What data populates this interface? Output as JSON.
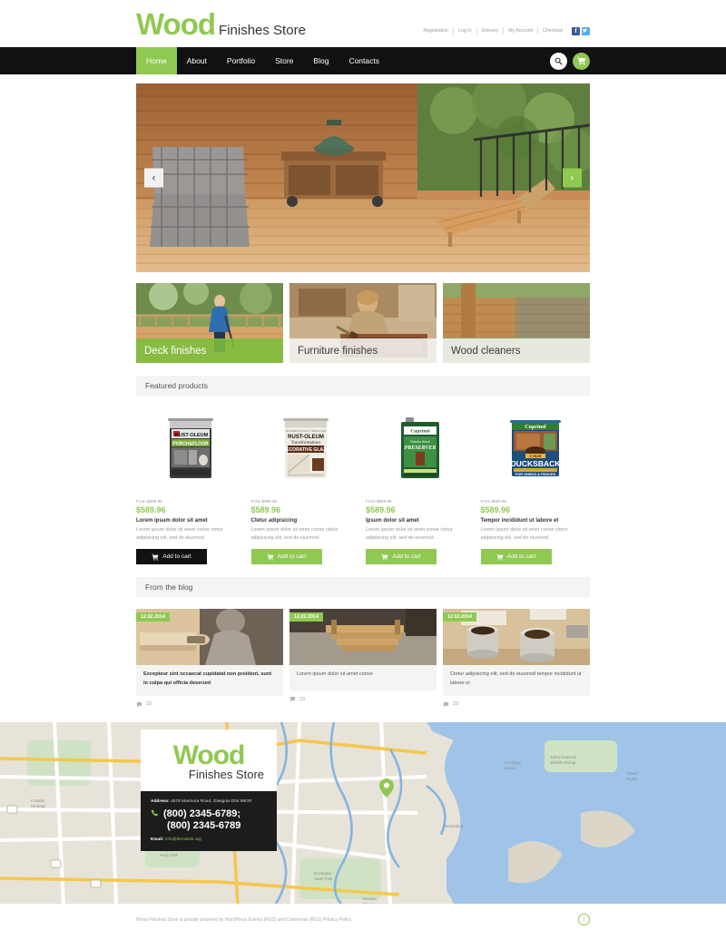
{
  "header": {
    "logo_main": "Wood",
    "logo_sub": "Finishes Store",
    "top_links": [
      {
        "label": "Registration"
      },
      {
        "label": "Log In"
      },
      {
        "label": "Delivery"
      },
      {
        "label": "My Account"
      },
      {
        "label": "Checkout"
      }
    ],
    "social": [
      {
        "name": "facebook-icon",
        "glyph": "f",
        "color": "#3b5998"
      },
      {
        "name": "twitter-icon",
        "glyph": "t",
        "color": "#55acee"
      }
    ]
  },
  "nav": {
    "items": [
      {
        "label": "Home",
        "active": true
      },
      {
        "label": "About",
        "active": false
      },
      {
        "label": "Portfolio",
        "active": false
      },
      {
        "label": "Store",
        "active": false
      },
      {
        "label": "Blog",
        "active": false
      },
      {
        "label": "Contacts",
        "active": false
      }
    ],
    "search_icon": "search-icon",
    "cart_icon": "cart-icon"
  },
  "slider": {
    "prev_label": "‹",
    "next_label": "›"
  },
  "categories": [
    {
      "label": "Deck finishes",
      "active": true
    },
    {
      "label": "Furniture finishes",
      "active": false
    },
    {
      "label": "Wood cleaners",
      "active": false
    }
  ],
  "featured": {
    "heading": "Featured products",
    "items": [
      {
        "from": "From $689.96",
        "price": "$589.96",
        "title": "Lorem ipsum dolor sit amet",
        "desc": "Lorem ipsum dolor sit amet conse ctetur adipisicing elit, sed do eiusmod.",
        "button": "Add to cart",
        "button_hovered": true,
        "product_image": "rustoleum-porch-floor-coating-can"
      },
      {
        "from": "From $689.96",
        "price": "$589.96",
        "title": "Ctetur adipisicing",
        "desc": "Lorem ipsum dolor sit amet conse ctetur adipisicing elit, sed do eiusmod.",
        "button": "Add to cart",
        "button_hovered": false,
        "product_image": "rustoleum-transformations-decorative-glaze-can"
      },
      {
        "from": "From $689.96",
        "price": "$589.96",
        "title": "Ipsum dolor sit amet",
        "desc": "Lorem ipsum dolor sit amet conse ctetur adipisicing elit, sed do eiusmod.",
        "button": "Add to cart",
        "button_hovered": false,
        "product_image": "cuprinol-exterior-wood-preserver-tin"
      },
      {
        "from": "From $689.96",
        "price": "$589.96",
        "title": "Tempor incididunt ut labore et",
        "desc": "Lorem ipsum dolor sit amet conse ctetur adipisicing elit, sed do eiusmod.",
        "button": "Add to cart",
        "button_hovered": false,
        "product_image": "cuprinol-ducksback-shed-fence-can"
      }
    ]
  },
  "blog": {
    "heading": "From the blog",
    "posts": [
      {
        "date": "12.02.2014",
        "title": "Excepteur sint occaecat cupidatat non proident, sunt in culpa qui officia deserunt",
        "comments": "23",
        "bold": true,
        "photo": "man-sanding-wood-plank"
      },
      {
        "date": "12.02.2014",
        "title": "Lorem ipsum dolor sit amet conse",
        "comments": "23",
        "bold": false,
        "photo": "wooden-picnic-table-outdoors"
      },
      {
        "date": "12.02.2014",
        "title": "Ctetur adipisicing elit, sed do eiusmod tempor incididunt ut labore et",
        "comments": "23",
        "bold": false,
        "photo": "open-paint-cans-on-bench"
      }
    ]
  },
  "contacts": {
    "logo_main": "Wood",
    "logo_sub": "Finishes Store",
    "address_label": "Address:",
    "address": "4578 Marmora Road, Glasgow D04 89GR",
    "phone_1": "(800) 2345-6789;",
    "phone_2": "(800) 2345-6789",
    "email_label": "Email:",
    "email": "info@demolink.org",
    "phone_icon": "phone-icon",
    "map_pin_icon": "map-pin-icon"
  },
  "footer": {
    "text": "Wood Finishes Store is proudly powered by WordPress Entries (RSS) and Comments (RSS) Privacy Policy",
    "to_top_icon": "arrow-up-circle-icon"
  },
  "colors": {
    "accent_green": "#8fc951",
    "dark": "#111111",
    "facebook": "#3b5998",
    "twitter": "#55acee"
  }
}
